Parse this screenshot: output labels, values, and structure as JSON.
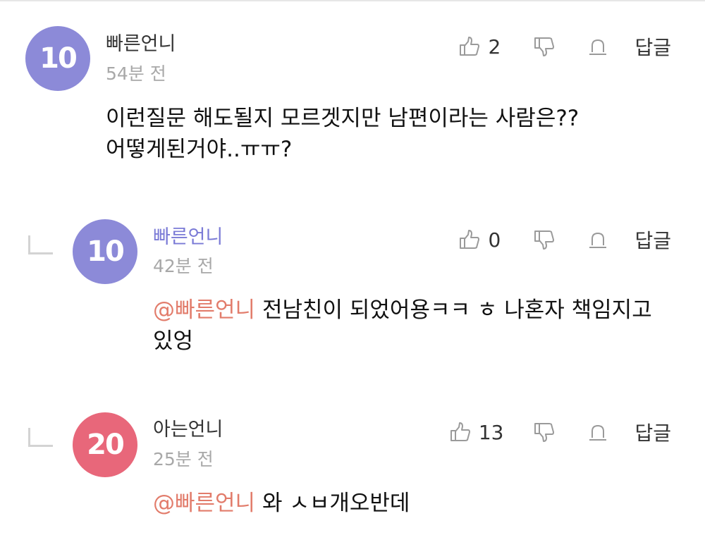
{
  "colors": {
    "avatar_purple": "#8c8ad8",
    "avatar_red": "#e8677a",
    "mention": "#e27c6b",
    "reply_author": "#7a7ad6",
    "muted": "#a8a8a8"
  },
  "icons": {
    "like": "thumbs-up-icon",
    "dislike": "thumbs-down-icon",
    "report": "bell-icon"
  },
  "comments": [
    {
      "badge": "10",
      "author": "빠른언니",
      "time": "54분 전",
      "likes": "2",
      "reply_label": "답글",
      "text": "이런질문 해도될지 모르겟지만 남편이라는 사람은?? 어떻게된거야..ㅠㅠ?"
    },
    {
      "badge": "10",
      "author": "빠른언니",
      "time": "42분 전",
      "likes": "0",
      "reply_label": "답글",
      "mention": "@빠른언니",
      "text": " 전남친이 되었어용ㅋㅋ ㅎ 나혼자 책임지고 있엉"
    },
    {
      "badge": "20",
      "author": "아는언니",
      "time": "25분 전",
      "likes": "13",
      "reply_label": "답글",
      "mention": "@빠른언니",
      "text": " 와 ㅅㅂ개오반데"
    }
  ]
}
